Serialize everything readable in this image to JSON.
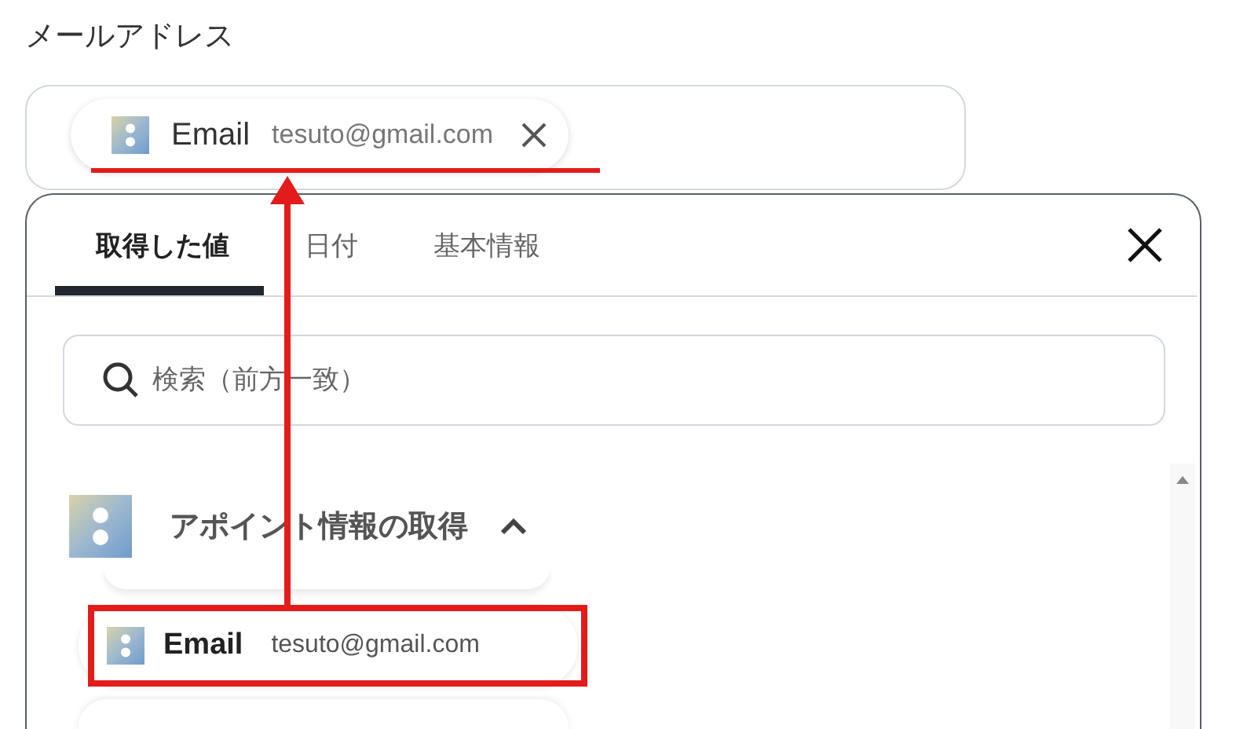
{
  "field": {
    "label": "メールアドレス",
    "chip": {
      "name": "Email",
      "value": "tesuto@gmail.com"
    }
  },
  "tabs": [
    {
      "label": "取得した値",
      "selected": true
    },
    {
      "label": "日付",
      "selected": false
    },
    {
      "label": "基本情報",
      "selected": false
    }
  ],
  "search": {
    "placeholder": "検索（前方一致）"
  },
  "group": {
    "title": "アポイント情報の取得",
    "expanded": true,
    "items": [
      {
        "name": "Email",
        "value": "tesuto@gmail.com"
      }
    ]
  }
}
